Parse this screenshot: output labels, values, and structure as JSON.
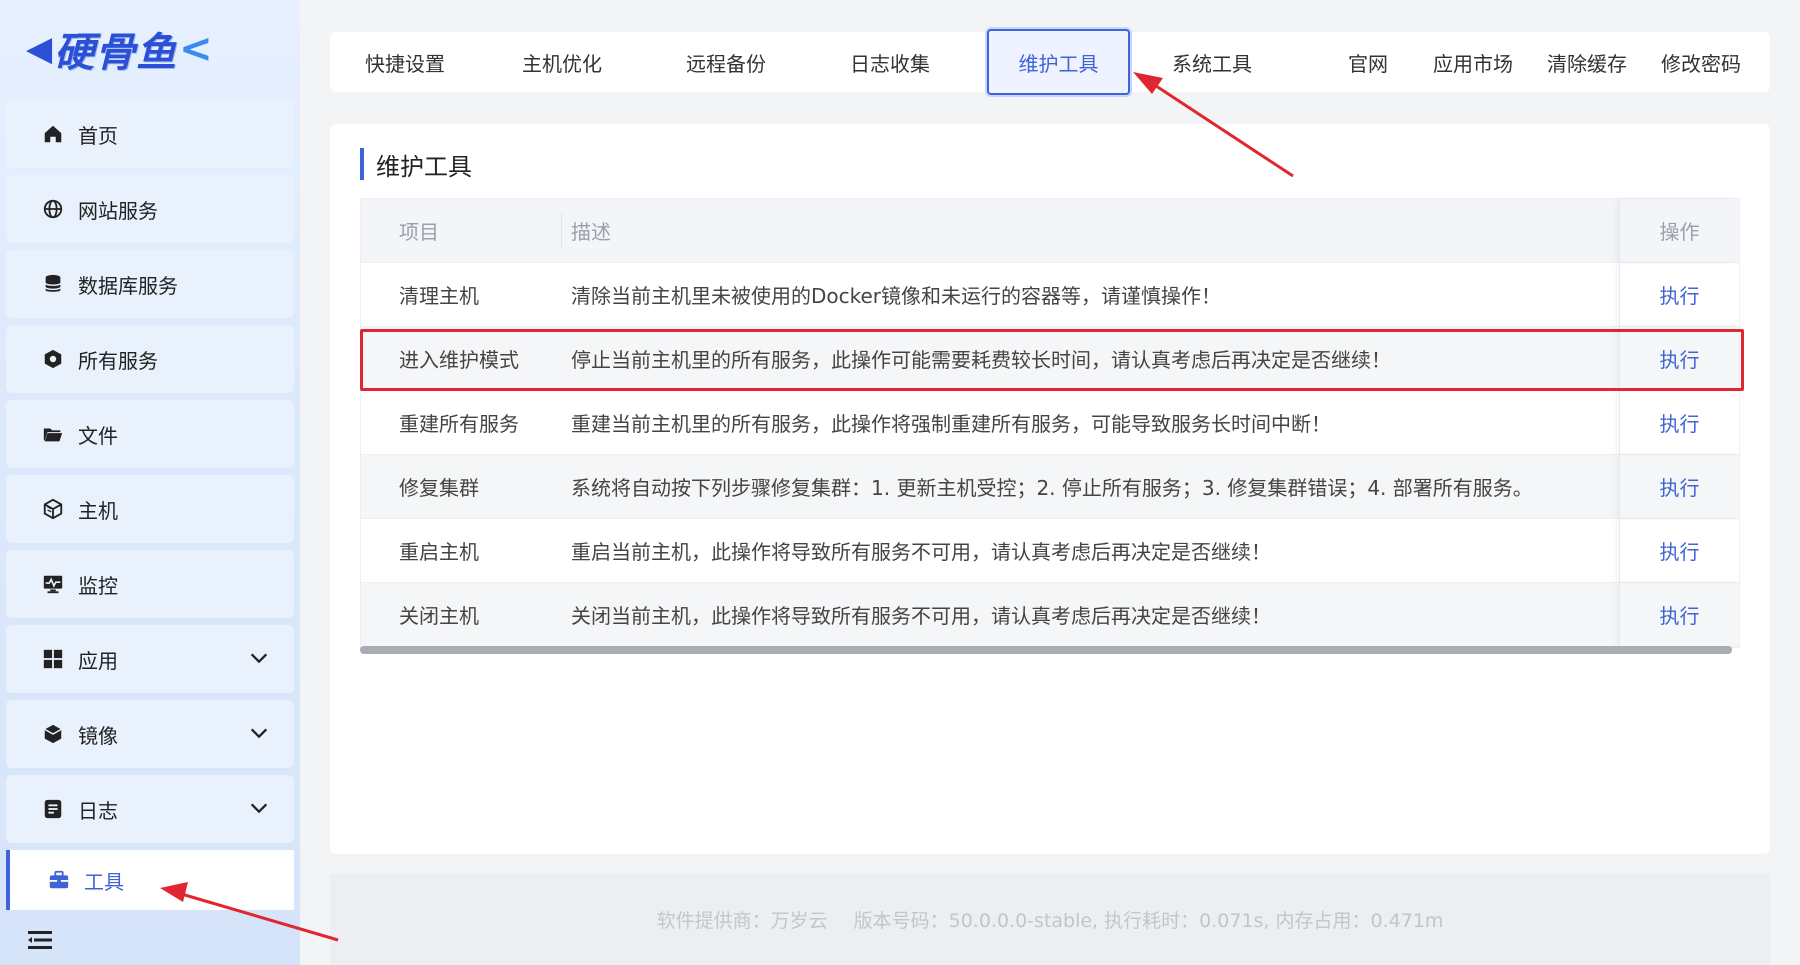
{
  "brand": {
    "logo_text": "硬骨鱼"
  },
  "sidebar": {
    "items": [
      {
        "label": "首页",
        "icon": "home-icon"
      },
      {
        "label": "网站服务",
        "icon": "globe-icon"
      },
      {
        "label": "数据库服务",
        "icon": "database-icon"
      },
      {
        "label": "所有服务",
        "icon": "services-icon"
      },
      {
        "label": "文件",
        "icon": "folder-icon"
      },
      {
        "label": "主机",
        "icon": "cube-icon"
      },
      {
        "label": "监控",
        "icon": "monitor-icon"
      },
      {
        "label": "应用",
        "icon": "grid-icon"
      },
      {
        "label": "镜像",
        "icon": "box-icon"
      },
      {
        "label": "日志",
        "icon": "log-icon"
      },
      {
        "label": "工具",
        "icon": "toolbox-icon"
      }
    ]
  },
  "tabs": [
    {
      "label": "快捷设置"
    },
    {
      "label": "主机优化"
    },
    {
      "label": "远程备份"
    },
    {
      "label": "日志收集"
    },
    {
      "label": "维护工具"
    },
    {
      "label": "系统工具"
    },
    {
      "label": "官网"
    },
    {
      "label": "应用市场"
    },
    {
      "label": "清除缓存"
    },
    {
      "label": "修改密码"
    }
  ],
  "panel": {
    "title": "维护工具",
    "columns": {
      "item": "项目",
      "desc": "描述",
      "action": "操作"
    },
    "rows": [
      {
        "item": "清理主机",
        "desc": "清除当前主机里未被使用的Docker镜像和未运行的容器等，请谨慎操作！",
        "action": "执行"
      },
      {
        "item": "进入维护模式",
        "desc": "停止当前主机里的所有服务，此操作可能需要耗费较长时间，请认真考虑后再决定是否继续！",
        "action": "执行"
      },
      {
        "item": "重建所有服务",
        "desc": "重建当前主机里的所有服务，此操作将强制重建所有服务，可能导致服务长时间中断！",
        "action": "执行"
      },
      {
        "item": "修复集群",
        "desc": "系统将自动按下列步骤修复集群：1. 更新主机受控；2. 停止所有服务；3. 修复集群错误；4. 部署所有服务。",
        "action": "执行"
      },
      {
        "item": "重启主机",
        "desc": "重启当前主机，此操作将导致所有服务不可用，请认真考虑后再决定是否继续！",
        "action": "执行"
      },
      {
        "item": "关闭主机",
        "desc": "关闭当前主机，此操作将导致所有服务不可用，请认真考虑后再决定是否继续！",
        "action": "执行"
      }
    ]
  },
  "footer": {
    "provider": "软件提供商：万岁云",
    "version": "版本号码：50.0.0.0-stable, 执行耗时：0.071s, 内存占用：0.471m"
  },
  "colors": {
    "accent": "#3f63d9",
    "annotation": "#e0262f"
  }
}
